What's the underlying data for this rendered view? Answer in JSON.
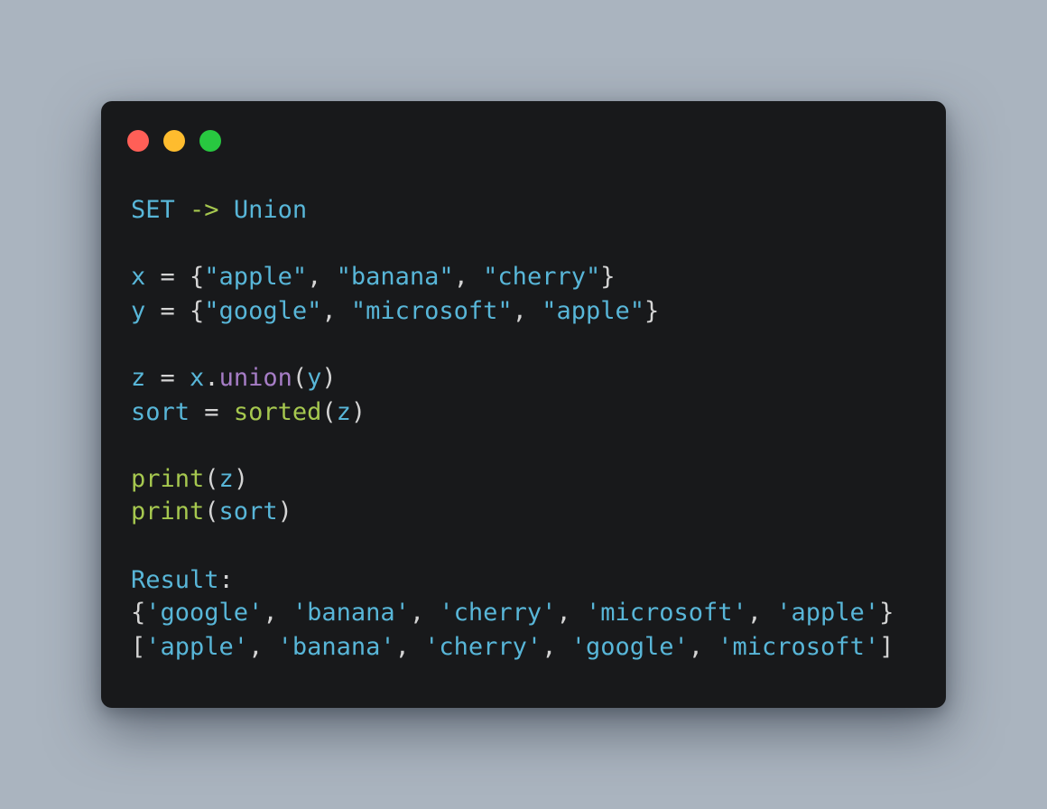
{
  "window": {
    "dots": [
      {
        "name": "close",
        "color": "#ff5f57"
      },
      {
        "name": "minimize",
        "color": "#febc2e"
      },
      {
        "name": "maximize",
        "color": "#28c840"
      }
    ]
  },
  "colors": {
    "background": "#aab4bf",
    "window": "#18191b",
    "identifier": "#58b6d8",
    "punctuation": "#d4d4d4",
    "builtin_function": "#a6c84f",
    "method": "#a67dc6"
  },
  "code": {
    "heading": {
      "left": "SET",
      "arrow": "->",
      "right": "Union"
    },
    "line_x": {
      "name": "x",
      "assign": " = {",
      "items": [
        "\"apple\"",
        "\"banana\"",
        "\"cherry\""
      ],
      "close": "}"
    },
    "line_y": {
      "name": "y",
      "assign": " = {",
      "items": [
        "\"google\"",
        "\"microsoft\"",
        "\"apple\""
      ],
      "close": "}"
    },
    "line_z": {
      "name": "z",
      "assign": " = ",
      "obj": "x",
      "dot": ".",
      "method": "union",
      "open": "(",
      "arg": "y",
      "close": ")"
    },
    "line_sort": {
      "name": "sort",
      "assign": " = ",
      "func": "sorted",
      "open": "(",
      "arg": "z",
      "close": ")"
    },
    "line_print1": {
      "func": "print",
      "open": "(",
      "arg": "z",
      "close": ")"
    },
    "line_print2": {
      "func": "print",
      "open": "(",
      "arg": "sort",
      "close": ")"
    },
    "result_label": {
      "text": "Result",
      "colon": ":"
    },
    "result_set": {
      "open": "{",
      "items": [
        "'google'",
        "'banana'",
        "'cherry'",
        "'microsoft'",
        "'apple'"
      ],
      "close": "}"
    },
    "result_list": {
      "open": "[",
      "items": [
        "'apple'",
        "'banana'",
        "'cherry'",
        "'google'",
        "'microsoft'"
      ],
      "close": "]"
    },
    "separator": ", "
  }
}
